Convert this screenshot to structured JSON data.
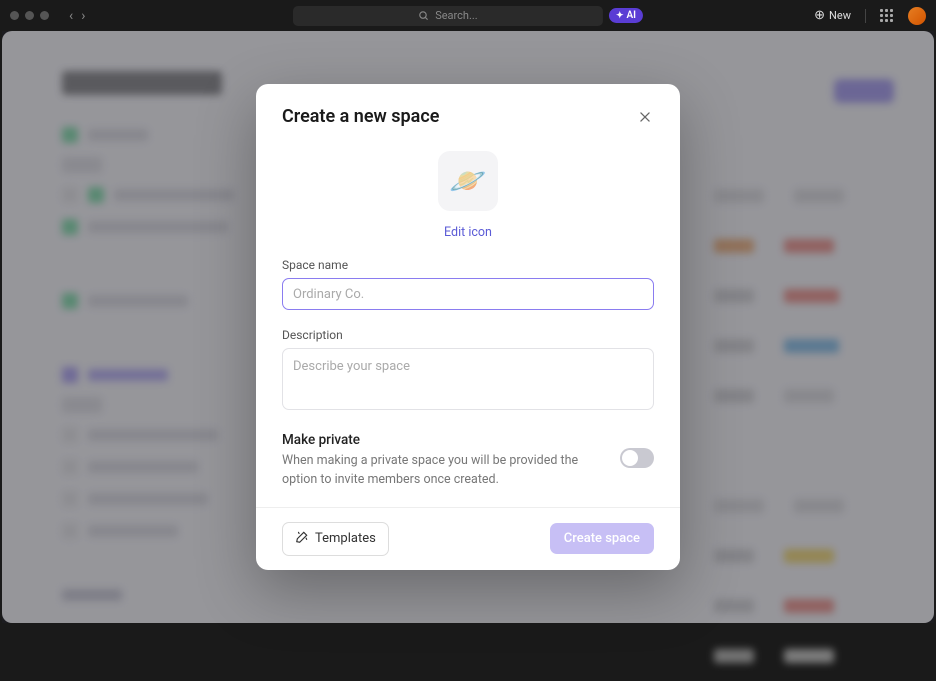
{
  "topbar": {
    "search_placeholder": "Search...",
    "ai_label": "AI",
    "new_label": "New"
  },
  "modal": {
    "title": "Create a new space",
    "icon_emoji": "🪐",
    "edit_icon_label": "Edit icon",
    "space_name_label": "Space name",
    "space_name_placeholder": "Ordinary Co.",
    "space_name_value": "",
    "description_label": "Description",
    "description_placeholder": "Describe your space",
    "description_value": "",
    "private_title": "Make private",
    "private_desc": "When making a private space you will be provided the option to invite members once created.",
    "templates_label": "Templates",
    "create_label": "Create space"
  }
}
